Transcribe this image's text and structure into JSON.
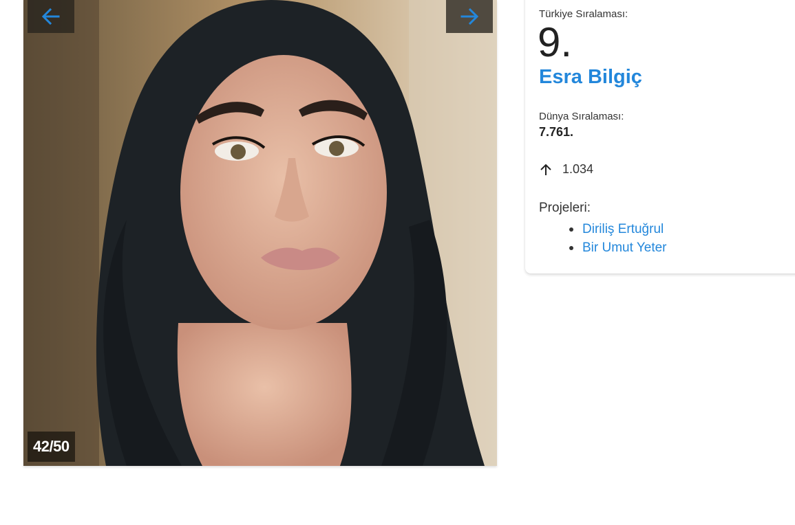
{
  "gallery": {
    "counter": "42/50",
    "prev_icon": "arrow-left-icon",
    "next_icon": "arrow-right-icon",
    "photo_subject": "portrait-photo"
  },
  "profile": {
    "turkey_rank_label": "Türkiye Sıralaması:",
    "turkey_rank": "9.",
    "name": "Esra Bilgiç",
    "world_rank_label": "Dünya Sıralaması:",
    "world_rank": "7.761.",
    "trend_icon": "arrow-up-icon",
    "trend_value": "1.034",
    "projects_label": "Projeleri:",
    "projects": [
      "Diriliş Ertuğrul",
      "Bir Umut Yeter"
    ]
  },
  "colors": {
    "accent": "#2387db",
    "text": "#222222"
  }
}
